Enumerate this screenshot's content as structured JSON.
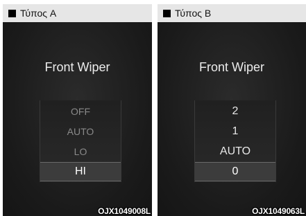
{
  "panels": [
    {
      "header": "Τύπος A",
      "title": "Front Wiper",
      "options": [
        "OFF",
        "AUTO",
        "LO",
        "HI"
      ],
      "selected": "HI",
      "code": "OJX1049008L"
    },
    {
      "header": "Τύπος B",
      "title": "Front Wiper",
      "options": [
        "2",
        "1",
        "AUTO",
        "0"
      ],
      "selected": "0",
      "code": "OJX1049063L"
    }
  ]
}
